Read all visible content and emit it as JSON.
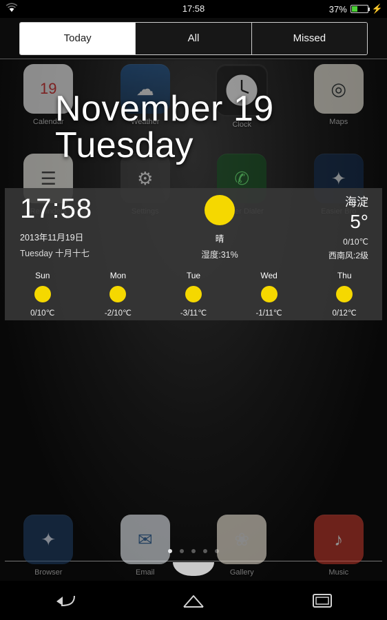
{
  "status_bar": {
    "wifi_icon": "wifi-icon",
    "time": "17:58",
    "battery_percent": "37%",
    "battery_level": 37,
    "charging_icon": "lightning-bolt-icon"
  },
  "notification_panel": {
    "tabs": [
      {
        "label": "Today",
        "active": true
      },
      {
        "label": "All",
        "active": false
      },
      {
        "label": "Missed",
        "active": false
      }
    ]
  },
  "lock_overlay": {
    "date_line1": "November 19",
    "date_line2": "Tuesday"
  },
  "weather_widget": {
    "clock": "17:58",
    "date_cn": "2013年11月19日",
    "date_sub": "Tuesday  十月十七",
    "condition_icon": "sun-icon",
    "condition": "晴",
    "humidity": "湿度:31%",
    "city": "海淀",
    "current_temp": "5°",
    "range": "0/10℃",
    "wind": "西南风:2级",
    "forecast": [
      {
        "day": "Sun",
        "icon": "sun-icon",
        "temp": "0/10℃"
      },
      {
        "day": "Mon",
        "icon": "sun-icon",
        "temp": "-2/10℃"
      },
      {
        "day": "Tue",
        "icon": "sun-icon",
        "temp": "-3/11℃"
      },
      {
        "day": "Wed",
        "icon": "sun-icon",
        "temp": "-1/11℃"
      },
      {
        "day": "Thu",
        "icon": "sun-icon",
        "temp": "0/12℃"
      }
    ]
  },
  "home_screen": {
    "row1": [
      {
        "label": "Calendar",
        "icon": "calendar-icon",
        "glyph": "19"
      },
      {
        "label": "Weather",
        "icon": "weather-icon",
        "glyph": "☁"
      },
      {
        "label": "Clock",
        "icon": "clock-icon",
        "glyph": "🕐"
      },
      {
        "label": "Maps",
        "icon": "maps-icon",
        "glyph": "◎"
      }
    ],
    "row2": [
      {
        "label": "Reminders",
        "icon": "reminders-icon",
        "glyph": "☰"
      },
      {
        "label": "Settings",
        "icon": "settings-icon",
        "glyph": "⚙"
      },
      {
        "label": "Easier Dialer",
        "icon": "dialer-icon",
        "glyph": "✆"
      },
      {
        "label": "Easier Bro",
        "icon": "compass-icon",
        "glyph": "✦"
      }
    ],
    "dock": [
      {
        "label": "Browser",
        "icon": "browser-icon",
        "glyph": "✦"
      },
      {
        "label": "Email",
        "icon": "email-icon",
        "glyph": "✉"
      },
      {
        "label": "Gallery",
        "icon": "gallery-icon",
        "glyph": "❀"
      },
      {
        "label": "Music",
        "icon": "music-icon",
        "glyph": "♪"
      }
    ],
    "page_dots": 5,
    "active_dot": 0
  },
  "nav_bar": {
    "buttons": [
      {
        "name": "back-button",
        "icon": "back-arrow-icon"
      },
      {
        "name": "home-button",
        "icon": "home-icon"
      },
      {
        "name": "recents-button",
        "icon": "recents-icon"
      }
    ]
  },
  "colors": {
    "accent_yellow": "#f5d800",
    "battery_green": "#4cd137",
    "widget_bg": "rgba(56,56,56,0.88)"
  }
}
